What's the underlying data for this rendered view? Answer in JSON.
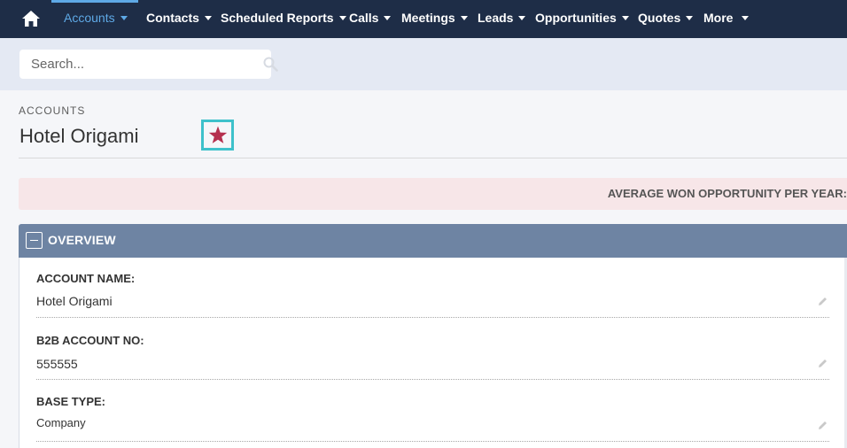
{
  "nav": {
    "items": [
      {
        "label": "Accounts",
        "active": true
      },
      {
        "label": "Contacts"
      },
      {
        "label": "Scheduled Reports"
      },
      {
        "label": "Calls"
      },
      {
        "label": "Meetings"
      },
      {
        "label": "Leads"
      },
      {
        "label": "Opportunities"
      },
      {
        "label": "Quotes"
      },
      {
        "label": "More"
      }
    ]
  },
  "search": {
    "placeholder": "Search..."
  },
  "header": {
    "module": "ACCOUNTS",
    "title": "Hotel Origami"
  },
  "alert": {
    "text": "AVERAGE WON OPPORTUNITY PER YEAR:"
  },
  "panel": {
    "title": "OVERVIEW",
    "fields": [
      {
        "label": "ACCOUNT NAME:",
        "value": "Hotel Origami"
      },
      {
        "label": "B2B ACCOUNT NO:",
        "value": "555555"
      },
      {
        "label": "BASE TYPE:",
        "value": "Company"
      }
    ]
  },
  "colors": {
    "nav_bg": "#1e2d47",
    "nav_active": "#5ea9e6",
    "favorite_star": "#b5304f",
    "panel_header": "#6e84a3",
    "alert_bg": "#f7e6e8",
    "focus_outline": "#3ec1cb"
  }
}
